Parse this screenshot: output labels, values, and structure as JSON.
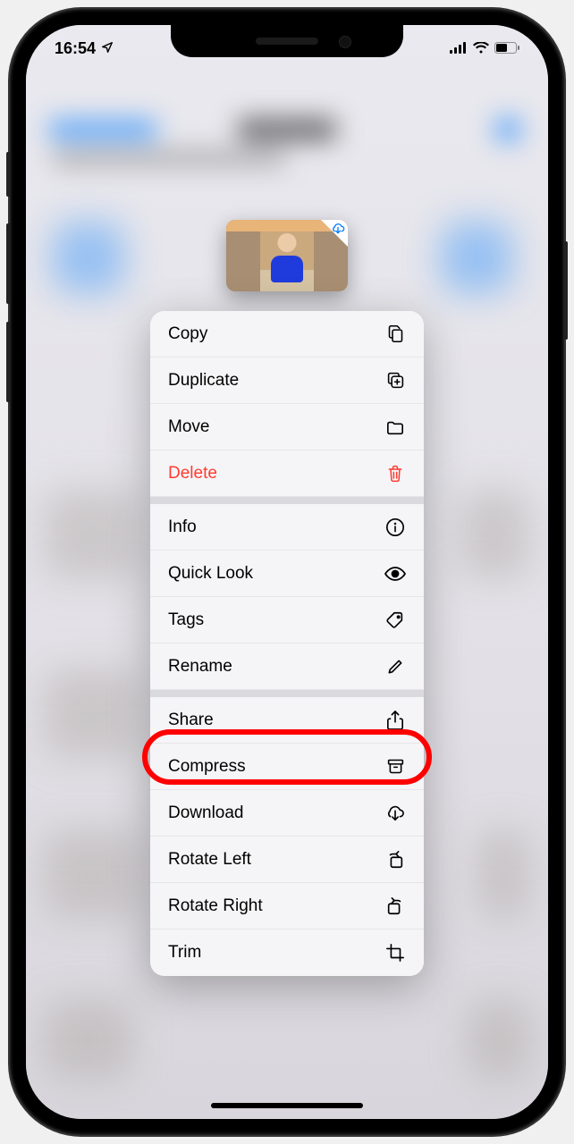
{
  "status": {
    "time": "16:54"
  },
  "menu": {
    "copy": "Copy",
    "duplicate": "Duplicate",
    "move": "Move",
    "delete": "Delete",
    "info": "Info",
    "quick_look": "Quick Look",
    "tags": "Tags",
    "rename": "Rename",
    "share": "Share",
    "compress": "Compress",
    "download": "Download",
    "rotate_left": "Rotate Left",
    "rotate_right": "Rotate Right",
    "trim": "Trim"
  },
  "highlighted": "compress"
}
